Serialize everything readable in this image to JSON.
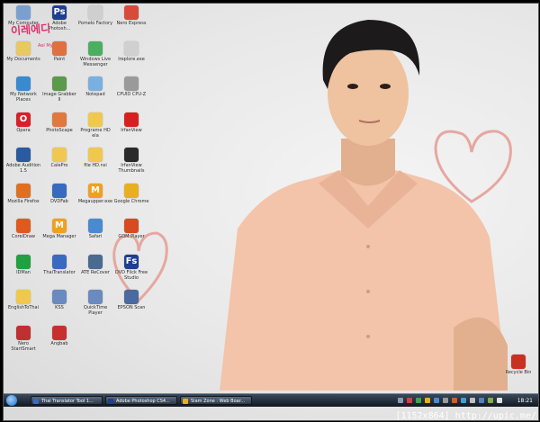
{
  "desktop_icons": [
    {
      "label": "My Computer",
      "color": "#7aa0d0",
      "glyph": ""
    },
    {
      "label": "Adobe Photosh...",
      "color": "#1f3f8f",
      "glyph": "Ps"
    },
    {
      "label": "Pomelo Factory",
      "color": "#cfcfcf",
      "glyph": ""
    },
    {
      "label": "Nero Express",
      "color": "#d84a3a",
      "glyph": ""
    },
    {
      "label": "My Documents",
      "color": "#e8c860",
      "glyph": ""
    },
    {
      "label": "Paint",
      "color": "#e07040",
      "glyph": ""
    },
    {
      "label": "Windows Live Messenger",
      "color": "#4ab060",
      "glyph": ""
    },
    {
      "label": "Ireplore.exe",
      "color": "#d0d0d0",
      "glyph": ""
    },
    {
      "label": "My Network Places",
      "color": "#3a8ad0",
      "glyph": ""
    },
    {
      "label": "Image Grabber II",
      "color": "#5a9a4a",
      "glyph": ""
    },
    {
      "label": "Notepad",
      "color": "#7ab0e0",
      "glyph": ""
    },
    {
      "label": "CPUID CPU-Z",
      "color": "#9a9a9a",
      "glyph": ""
    },
    {
      "label": "Opera",
      "color": "#d8202a",
      "glyph": "O"
    },
    {
      "label": "PhotoScape",
      "color": "#e07840",
      "glyph": ""
    },
    {
      "label": "Programe HD ela",
      "color": "#f0c850",
      "glyph": ""
    },
    {
      "label": "IrfanView",
      "color": "#d82020",
      "glyph": ""
    },
    {
      "label": "Adobe Audition 1.5",
      "color": "#2a5aa0",
      "glyph": ""
    },
    {
      "label": "CalePro",
      "color": "#f0c850",
      "glyph": ""
    },
    {
      "label": "file HD.nsi",
      "color": "#f0c850",
      "glyph": ""
    },
    {
      "label": "IrfanView Thumbnails",
      "color": "#2a2a2a",
      "glyph": ""
    },
    {
      "label": "Mozilla Firefox",
      "color": "#e07020",
      "glyph": ""
    },
    {
      "label": "DVDFab",
      "color": "#3a6ac0",
      "glyph": ""
    },
    {
      "label": "Megaupper.exe",
      "color": "#f0a020",
      "glyph": "M"
    },
    {
      "label": "Google Chrome",
      "color": "#e8b020",
      "glyph": ""
    },
    {
      "label": "CorelDraw",
      "color": "#e05a20",
      "glyph": ""
    },
    {
      "label": "Mega Manager",
      "color": "#f0a020",
      "glyph": "M"
    },
    {
      "label": "Safari",
      "color": "#4a8ad0",
      "glyph": ""
    },
    {
      "label": "GOM Player",
      "color": "#d84a20",
      "glyph": ""
    },
    {
      "label": "IDMan",
      "color": "#20a040",
      "glyph": ""
    },
    {
      "label": "ThaiTranslator",
      "color": "#3a6ac0",
      "glyph": ""
    },
    {
      "label": "ATE ReCover",
      "color": "#4a6a90",
      "glyph": ""
    },
    {
      "label": "DVD Flick Free Studio",
      "color": "#1f3f8f",
      "glyph": "Fs"
    },
    {
      "label": "EnglishToThai",
      "color": "#f0c850",
      "glyph": ""
    },
    {
      "label": "KSS",
      "color": "#6a8ac0",
      "glyph": ""
    },
    {
      "label": "QuickTime Player",
      "color": "#6a8ac0",
      "glyph": ""
    },
    {
      "label": "EPSON Scan",
      "color": "#4a6aa0",
      "glyph": ""
    },
    {
      "label": "Nero StartSmart",
      "color": "#c03030",
      "glyph": ""
    },
    {
      "label": "Angbab",
      "color": "#c83030",
      "glyph": ""
    },
    {
      "label": "Recycle Bin",
      "color": "#c83020",
      "glyph": ""
    }
  ],
  "logo": {
    "text": "이레에디",
    "sub": "Aei My Lady"
  },
  "taskbar": {
    "tasks": [
      {
        "label": "Thai Translator Tool 1...",
        "color": "#3a6ac0"
      },
      {
        "label": "Adobe Photoshop CS4...",
        "color": "#1f3f8f"
      },
      {
        "label": "Siam Zone : Web Boar...",
        "color": "#e8b020"
      }
    ],
    "clock": "18:21"
  },
  "watermark": "[1152x864] http://upic.me/"
}
